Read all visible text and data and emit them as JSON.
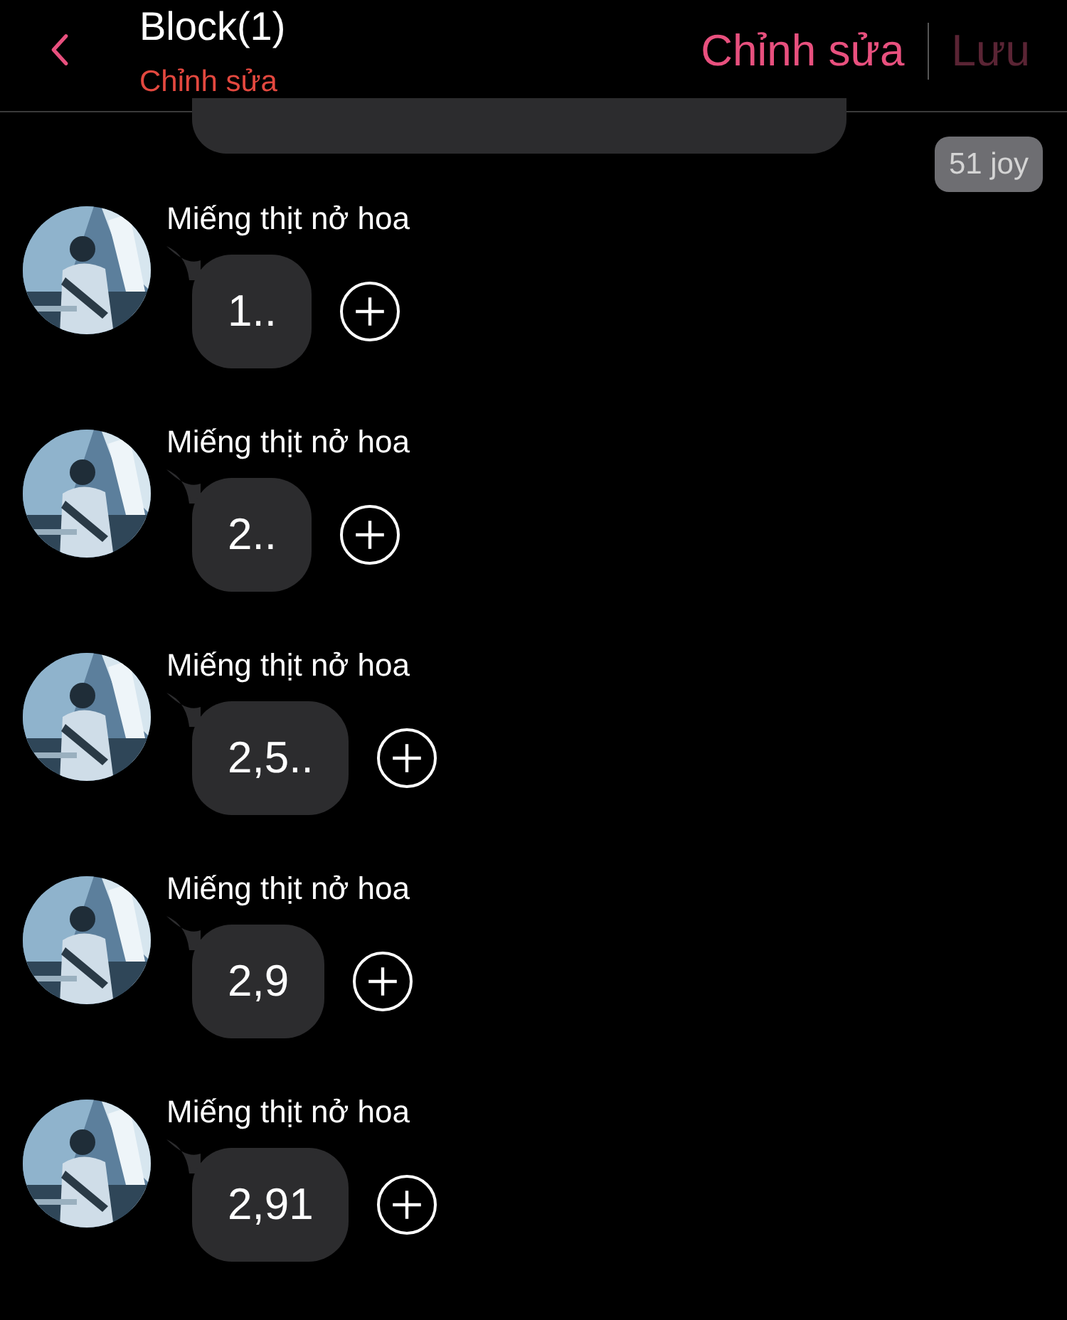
{
  "header": {
    "title": "Block(1)",
    "subtitle": "Chỉnh sửa",
    "edit_button": "Chỉnh sửa",
    "save_button": {
      "label": "Lưu",
      "disabled": true
    }
  },
  "badge": "51 joy",
  "messages": [
    {
      "sender": "Miếng thịt nở hoa",
      "text": "1.."
    },
    {
      "sender": "Miếng thịt nở hoa",
      "text": "2.."
    },
    {
      "sender": "Miếng thịt nở hoa",
      "text": "2,5.."
    },
    {
      "sender": "Miếng thịt nở hoa",
      "text": "2,9"
    },
    {
      "sender": "Miếng thịt nở hoa",
      "text": "2,91"
    }
  ]
}
